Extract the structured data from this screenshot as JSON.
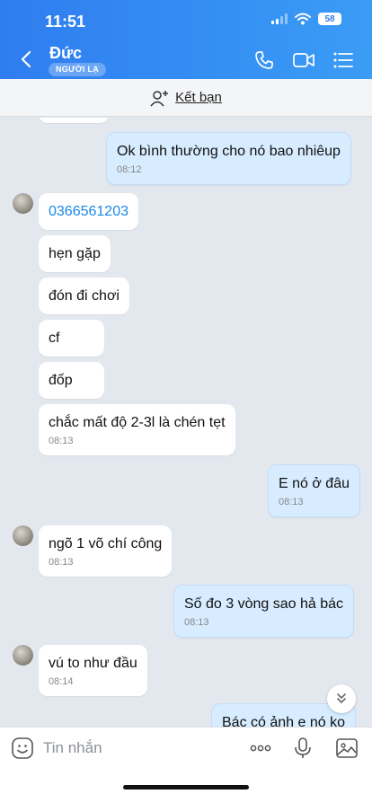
{
  "status_bar": {
    "time": "11:51",
    "battery": "58"
  },
  "header": {
    "contact_name": "Đức",
    "stranger_badge": "NGƯỜI LẠ"
  },
  "add_friend": {
    "label": "Kết bạn"
  },
  "messages": [
    {
      "direction": "out",
      "text": "Ok bình thường cho nó bao nhiêup",
      "time": "08:12"
    },
    {
      "direction": "in",
      "text": "0366561203",
      "time": ""
    },
    {
      "direction": "in",
      "text": "hẹn gặp",
      "time": ""
    },
    {
      "direction": "in",
      "text": "đón đi chơi",
      "time": ""
    },
    {
      "direction": "in",
      "text": "cf",
      "time": ""
    },
    {
      "direction": "in",
      "text": "đốp",
      "time": ""
    },
    {
      "direction": "in",
      "text": "chắc mất độ 2-3l là chén tẹt",
      "time": "08:13"
    },
    {
      "direction": "out",
      "text": "E nó ở đâu",
      "time": "08:13"
    },
    {
      "direction": "in",
      "text": "ngõ 1 võ chí công",
      "time": "08:13"
    },
    {
      "direction": "out",
      "text": "Số đo 3 vòng sao hả bác",
      "time": "08:13"
    },
    {
      "direction": "in",
      "text": "vú to như đầu",
      "time": "08:14"
    },
    {
      "direction": "out",
      "text": "Bác có ảnh e nó ko",
      "time": ""
    }
  ],
  "input": {
    "placeholder": "Tin nhắn"
  },
  "colors": {
    "header_blue": "#2f7df0",
    "outgoing_bubble": "#d7ecff",
    "chat_background": "#e3e8ef",
    "link_blue": "#1a88e6"
  }
}
